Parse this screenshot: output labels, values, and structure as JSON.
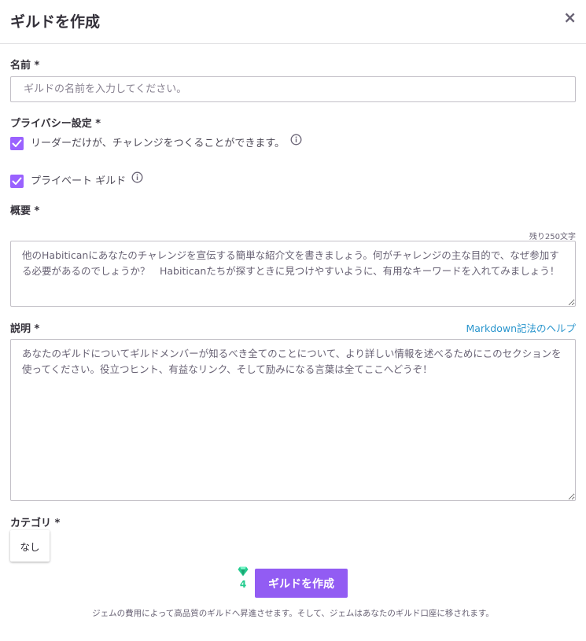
{
  "modal": {
    "title": "ギルドを作成",
    "close_label": "×"
  },
  "name_field": {
    "label": "名前 *",
    "placeholder": "ギルドの名前を入力してください。",
    "value": ""
  },
  "privacy": {
    "label": "プライバシー設定 *",
    "options": [
      {
        "label": "リーダーだけが、チャレンジをつくることができます。",
        "checked": true
      },
      {
        "label": "プライベート ギルド",
        "checked": true
      }
    ]
  },
  "summary_field": {
    "label": "概要 *",
    "counter": "残り250文字",
    "placeholder": "他のHabiticanにあなたのチャレンジを宣伝する簡単な紹介文を書きましょう。何がチャレンジの主な目的で、なぜ参加する必要があるのでしょうか？　Habiticanたちが探すときに見つけやすいように、有用なキーワードを入れてみましょう！"
  },
  "description_field": {
    "label": "説明 *",
    "help_link": "Markdown記法のヘルプ",
    "placeholder": "あなたのギルドについてギルドメンバーが知るべき全てのことについて、より詳しい情報を述べるためにこのセクションを使ってください。役立つヒント、有益なリンク、そして励みになる言葉は全てここへどうぞ！"
  },
  "category_field": {
    "label": "カテゴリ *",
    "selected": "なし"
  },
  "create": {
    "gem_icon": "gem-icon",
    "gem_cost": "4",
    "button_label": "ギルドを作成",
    "note": "ジェムの費用によって高品質のギルドへ昇進させます。そして、ジェムはあなたのギルド口座に移されます。"
  },
  "colors": {
    "accent": "#9a62ff",
    "button": "#925cf3",
    "gem": "#24cc8f",
    "link": "#2995cd"
  }
}
